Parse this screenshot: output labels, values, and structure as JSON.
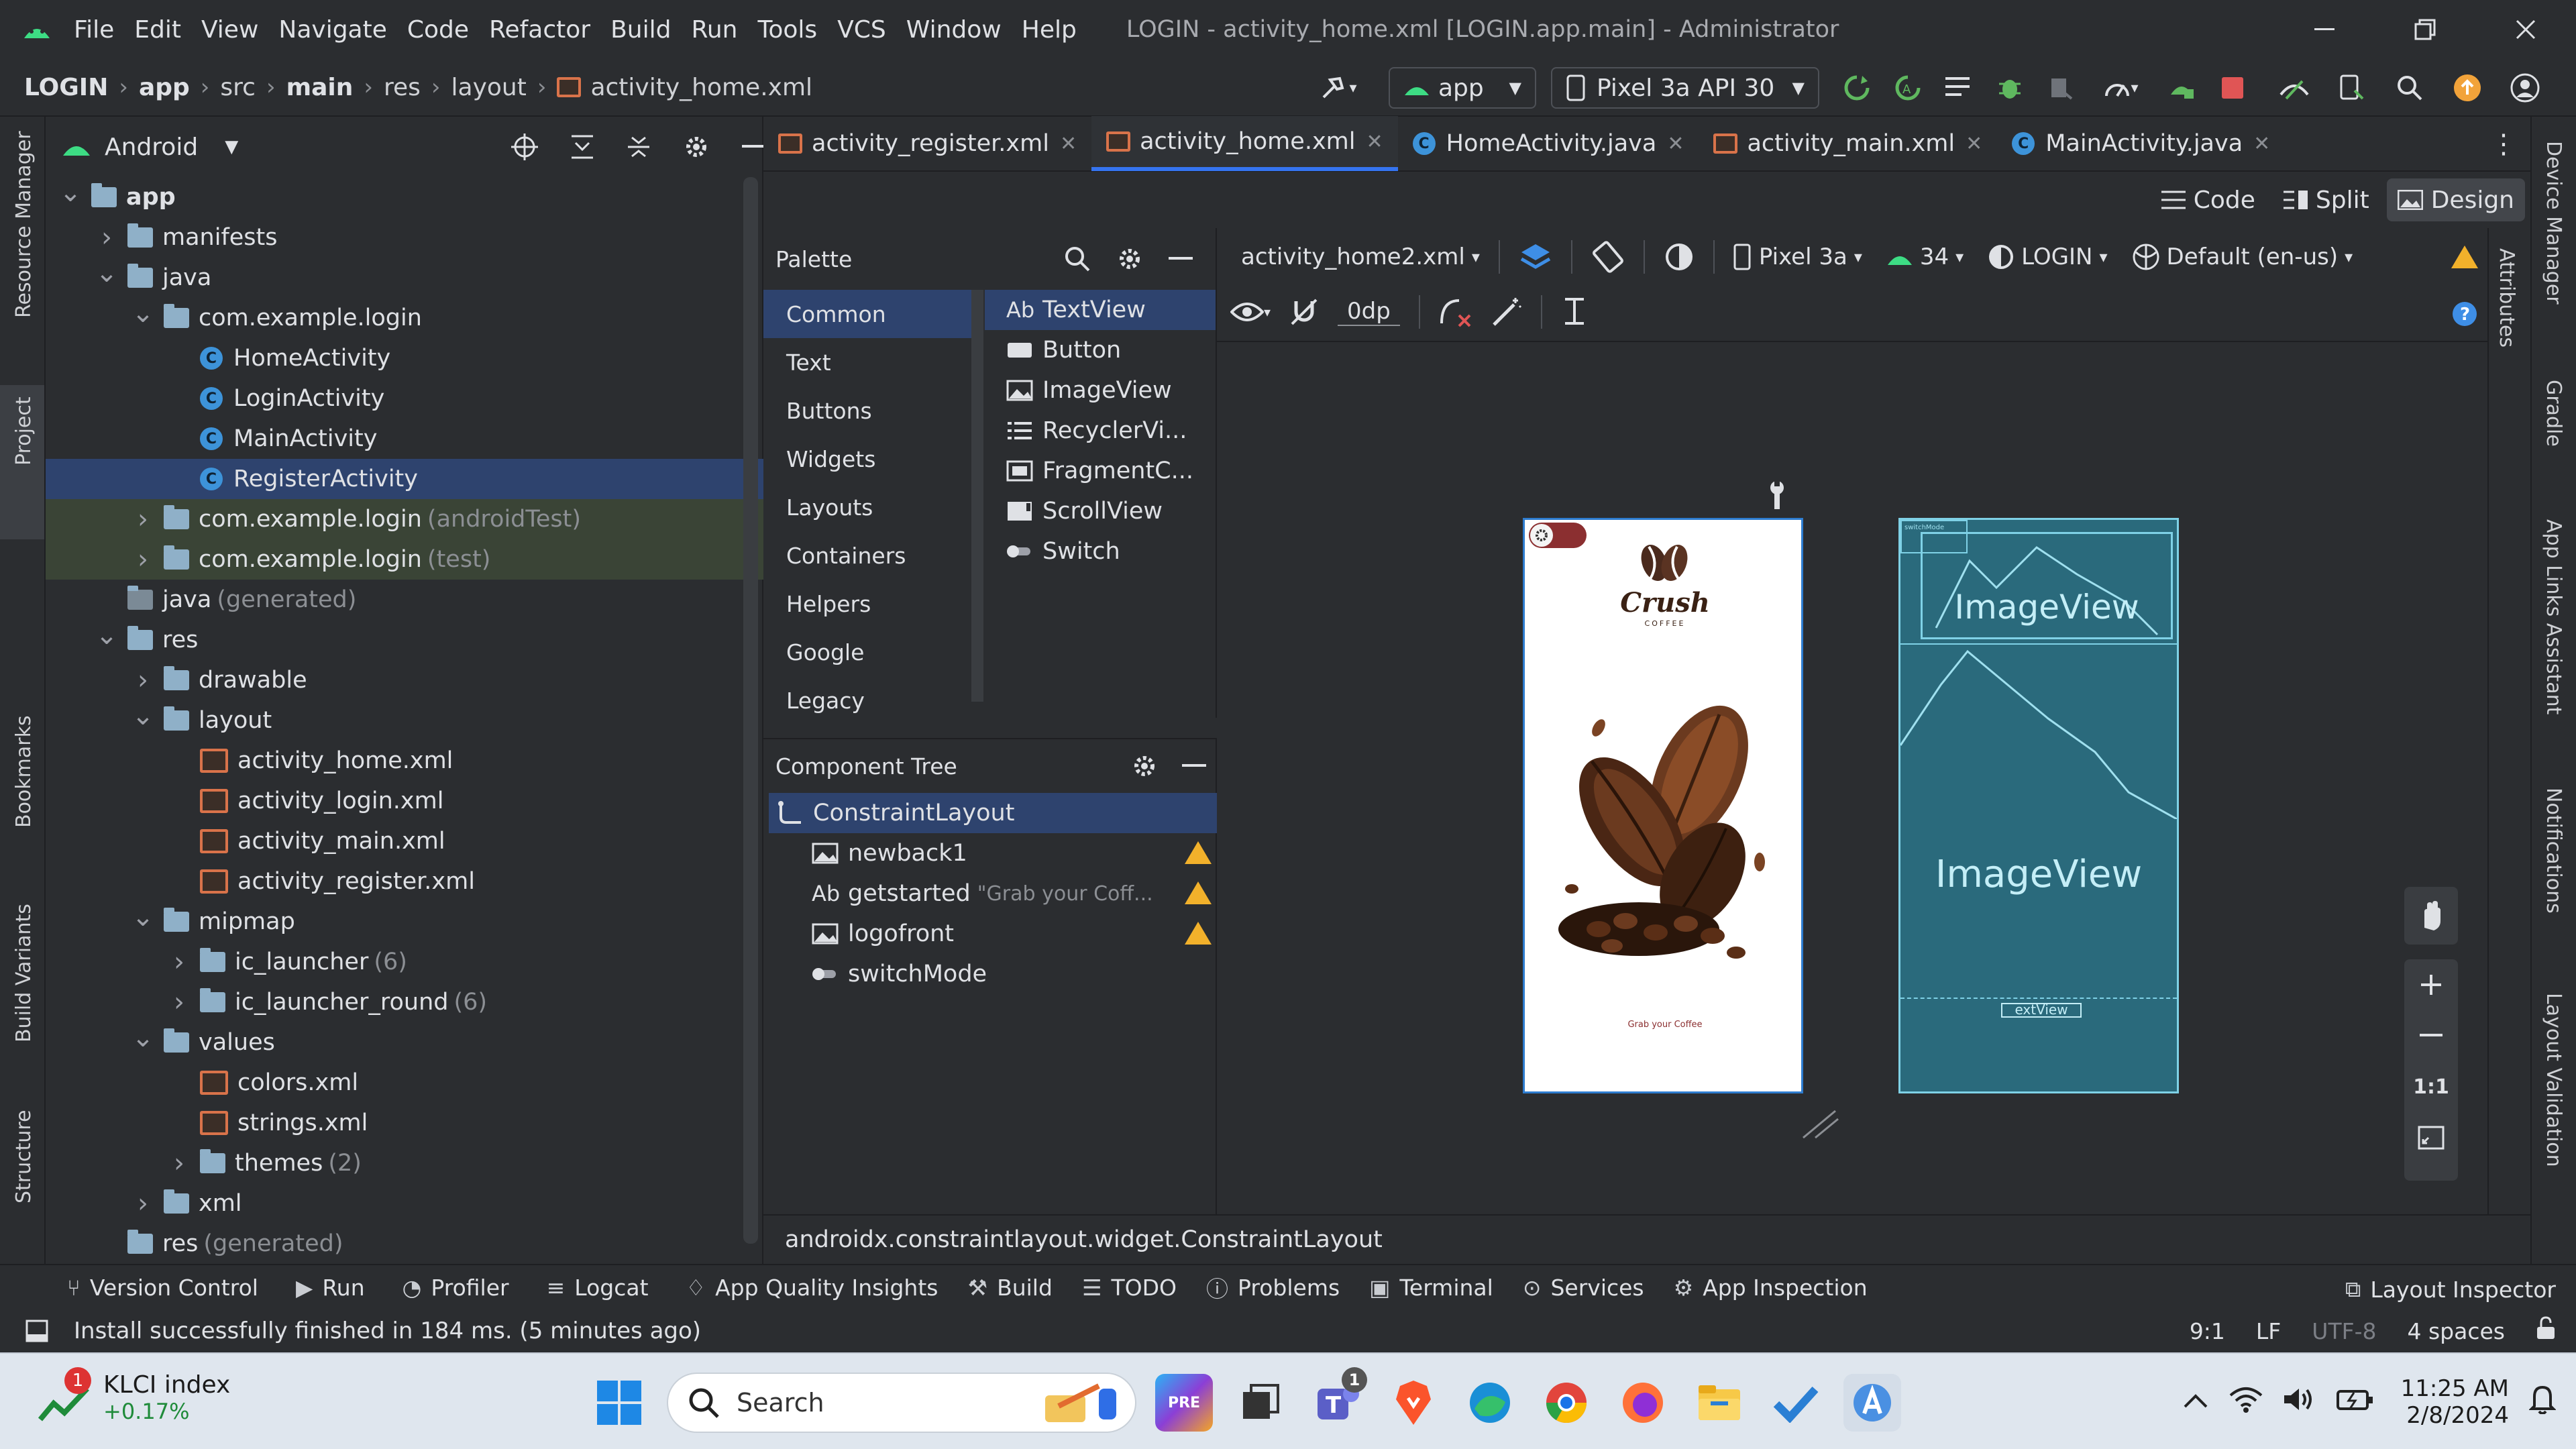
{
  "window": {
    "title": "LOGIN - activity_home.xml [LOGIN.app.main] - Administrator",
    "menu": [
      "File",
      "Edit",
      "View",
      "Navigate",
      "Code",
      "Refactor",
      "Build",
      "Run",
      "Tools",
      "VCS",
      "Window",
      "Help"
    ]
  },
  "breadcrumb": [
    "LOGIN",
    "app",
    "src",
    "main",
    "res",
    "layout",
    "activity_home.xml"
  ],
  "run_config": {
    "module": "app",
    "device": "Pixel 3a API 30"
  },
  "left_strip": {
    "top": [
      "Resource Manager",
      "Project"
    ],
    "bottom": [
      "Bookmarks",
      "Build Variants",
      "Structure"
    ]
  },
  "right_strip": [
    "Device Manager",
    "Gradle",
    "App Links Assistant",
    "Notifications",
    "Layout Validation"
  ],
  "attributes_label": "Attributes",
  "project": {
    "view_selector": "Android",
    "tree": [
      {
        "label": "app",
        "extra": "",
        "level": 0,
        "kind": "folder-bold",
        "arrow": "v"
      },
      {
        "label": "manifests",
        "extra": "",
        "level": 1,
        "kind": "folder",
        "arrow": ">"
      },
      {
        "label": "java",
        "extra": "",
        "level": 1,
        "kind": "folder",
        "arrow": "v"
      },
      {
        "label": "com.example.login",
        "extra": "",
        "level": 2,
        "kind": "folder",
        "arrow": "v"
      },
      {
        "label": "HomeActivity",
        "extra": "",
        "level": 3,
        "kind": "class",
        "arrow": ""
      },
      {
        "label": "LoginActivity",
        "extra": "",
        "level": 3,
        "kind": "class",
        "arrow": ""
      },
      {
        "label": "MainActivity",
        "extra": "",
        "level": 3,
        "kind": "class",
        "arrow": ""
      },
      {
        "label": "RegisterActivity",
        "extra": "",
        "level": 3,
        "kind": "class",
        "arrow": "",
        "selected": true
      },
      {
        "label": "com.example.login",
        "extra": "(androidTest)",
        "level": 2,
        "kind": "folder",
        "arrow": ">",
        "tint": true
      },
      {
        "label": "com.example.login",
        "extra": "(test)",
        "level": 2,
        "kind": "folder",
        "arrow": ">",
        "tint": true
      },
      {
        "label": "java",
        "extra": "(generated)",
        "level": 1,
        "kind": "folder-gen",
        "arrow": ""
      },
      {
        "label": "res",
        "extra": "",
        "level": 1,
        "kind": "folder",
        "arrow": "v"
      },
      {
        "label": "drawable",
        "extra": "",
        "level": 2,
        "kind": "folder",
        "arrow": ">"
      },
      {
        "label": "layout",
        "extra": "",
        "level": 2,
        "kind": "folder",
        "arrow": "v"
      },
      {
        "label": "activity_home.xml",
        "extra": "",
        "level": 3,
        "kind": "xml",
        "arrow": ""
      },
      {
        "label": "activity_login.xml",
        "extra": "",
        "level": 3,
        "kind": "xml",
        "arrow": ""
      },
      {
        "label": "activity_main.xml",
        "extra": "",
        "level": 3,
        "kind": "xml",
        "arrow": ""
      },
      {
        "label": "activity_register.xml",
        "extra": "",
        "level": 3,
        "kind": "xml",
        "arrow": ""
      },
      {
        "label": "mipmap",
        "extra": "",
        "level": 2,
        "kind": "folder",
        "arrow": "v"
      },
      {
        "label": "ic_launcher",
        "extra": "(6)",
        "level": 3,
        "kind": "folder",
        "arrow": ">"
      },
      {
        "label": "ic_launcher_round",
        "extra": "(6)",
        "level": 3,
        "kind": "folder",
        "arrow": ">"
      },
      {
        "label": "values",
        "extra": "",
        "level": 2,
        "kind": "folder",
        "arrow": "v"
      },
      {
        "label": "colors.xml",
        "extra": "",
        "level": 3,
        "kind": "xml",
        "arrow": ""
      },
      {
        "label": "strings.xml",
        "extra": "",
        "level": 3,
        "kind": "xml",
        "arrow": ""
      },
      {
        "label": "themes",
        "extra": "(2)",
        "level": 3,
        "kind": "folder",
        "arrow": ">"
      },
      {
        "label": "xml",
        "extra": "",
        "level": 2,
        "kind": "folder",
        "arrow": ">"
      },
      {
        "label": "res",
        "extra": "(generated)",
        "level": 1,
        "kind": "folder",
        "arrow": ""
      }
    ]
  },
  "tabs": [
    {
      "label": "activity_register.xml",
      "kind": "xml",
      "active": false
    },
    {
      "label": "activity_home.xml",
      "kind": "xml",
      "active": true
    },
    {
      "label": "HomeActivity.java",
      "kind": "class",
      "active": false
    },
    {
      "label": "activity_main.xml",
      "kind": "xml",
      "active": false
    },
    {
      "label": "MainActivity.java",
      "kind": "class",
      "active": false
    }
  ],
  "view_modes": {
    "code": "Code",
    "split": "Split",
    "design": "Design"
  },
  "palette": {
    "title": "Palette",
    "categories": [
      "Common",
      "Text",
      "Buttons",
      "Widgets",
      "Layouts",
      "Containers",
      "Helpers",
      "Google",
      "Legacy"
    ],
    "items": [
      {
        "icon": "Ab",
        "label": "TextView"
      },
      {
        "icon": "btn",
        "label": "Button"
      },
      {
        "icon": "img",
        "label": "ImageView"
      },
      {
        "icon": "list",
        "label": "RecyclerVi..."
      },
      {
        "icon": "frag",
        "label": "FragmentC..."
      },
      {
        "icon": "scroll",
        "label": "ScrollView"
      },
      {
        "icon": "switch",
        "label": "Switch"
      }
    ]
  },
  "component_tree": {
    "title": "Component Tree",
    "root": "ConstraintLayout",
    "children": [
      {
        "icon": "img",
        "label": "newback1",
        "hint": "",
        "warn": true
      },
      {
        "icon": "Ab",
        "label": "getstarted",
        "hint": "\"Grab your Coff...",
        "warn": true
      },
      {
        "icon": "img",
        "label": "logofront",
        "hint": "",
        "warn": true
      },
      {
        "icon": "switch",
        "label": "switchMode",
        "hint": "",
        "warn": false
      }
    ]
  },
  "design_toolbar": {
    "file": "activity_home2.xml",
    "device": "Pixel 3a",
    "api": "34",
    "theme": "LOGIN",
    "locale": "Default (en-us)",
    "margin": "0dp"
  },
  "preview": {
    "brand": "Crush",
    "brand_sub": "COFFEE",
    "caption": "Grab your Coffee"
  },
  "blueprint": {
    "top_image": "ImageView",
    "main_image": "ImageView",
    "text": "extView",
    "small_label": "switchMode"
  },
  "zoom": {
    "one_to_one": "1:1"
  },
  "status_path": "androidx.constraintlayout.widget.ConstraintLayout",
  "tool_windows": [
    "Version Control",
    "Run",
    "Profiler",
    "Logcat",
    "App Quality Insights",
    "Build",
    "TODO",
    "Problems",
    "Terminal",
    "Services",
    "App Inspection"
  ],
  "layout_inspector": "Layout Inspector",
  "status": {
    "message": "Install successfully finished in 184 ms. (5 minutes ago)",
    "pos": "9:1",
    "lf": "LF",
    "enc": "UTF-8",
    "indent": "4 spaces"
  },
  "taskbar": {
    "widget_title": "KLCI index",
    "widget_value": "+0.17%",
    "badge": "1",
    "search": "Search",
    "time": "11:25 AM",
    "date": "2/8/2024",
    "teams_badge": "1"
  }
}
